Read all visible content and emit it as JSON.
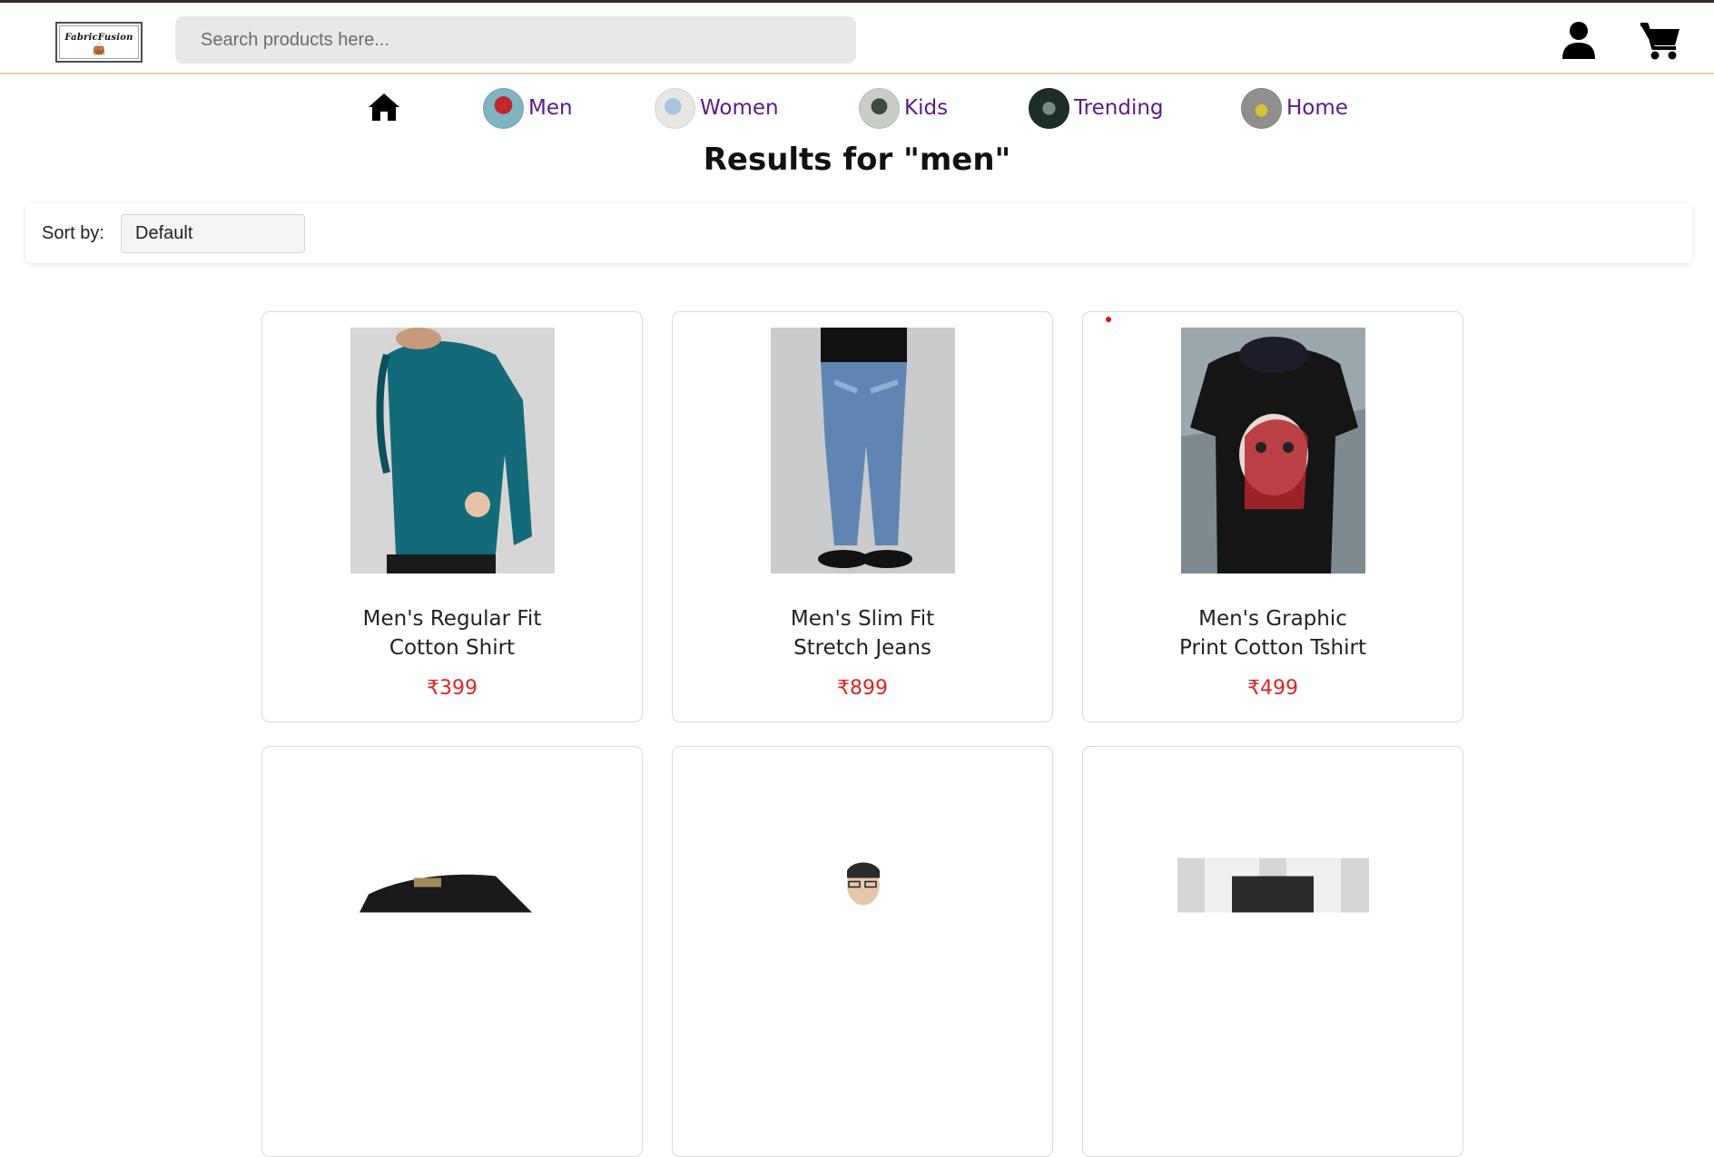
{
  "header": {
    "logo_text": "FabricFusion",
    "search_placeholder": "Search products here...",
    "icons": [
      "user-icon",
      "cart-icon"
    ]
  },
  "nav": {
    "home_icon": "home-icon",
    "items": [
      {
        "label": "Men"
      },
      {
        "label": "Women"
      },
      {
        "label": "Kids"
      },
      {
        "label": "Trending"
      },
      {
        "label": "Home"
      }
    ]
  },
  "results": {
    "title": "Results for \"men\""
  },
  "sort": {
    "label": "Sort by:",
    "selected": "Default"
  },
  "products": [
    {
      "name_line1": "Men's Regular Fit",
      "name_line2": "Cotton Shirt",
      "price": "₹399"
    },
    {
      "name_line1": "Men's Slim Fit",
      "name_line2": "Stretch Jeans",
      "price": "₹899"
    },
    {
      "name_line1": "Men's Graphic",
      "name_line2": "Print Cotton Tshirt",
      "price": "₹499"
    },
    {
      "name_line1": "",
      "name_line2": "",
      "price": ""
    },
    {
      "name_line1": "",
      "name_line2": "",
      "price": ""
    },
    {
      "name_line1": "",
      "name_line2": "",
      "price": ""
    }
  ],
  "colors": {
    "nav_text": "#5b1a8a",
    "price": "#e02424",
    "header_border": "#f7c9a8"
  }
}
